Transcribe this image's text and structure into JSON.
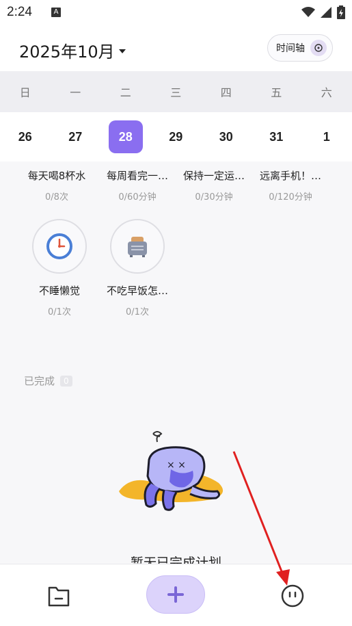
{
  "status_bar": {
    "time": "2:24",
    "notification_glyph": "A"
  },
  "header": {
    "month": "2025年10月",
    "timeline_label": "时间轴"
  },
  "weekdays": [
    "日",
    "一",
    "二",
    "三",
    "四",
    "五",
    "六"
  ],
  "dates": [
    "26",
    "27",
    "28",
    "29",
    "30",
    "31",
    "1"
  ],
  "selected_date": "28",
  "accent_color": "#8a6ef0",
  "habits_row1": [
    {
      "name": "每天喝8杯水",
      "progress": "0/8次"
    },
    {
      "name": "每周看完一…",
      "progress": "0/60分钟"
    },
    {
      "name": "保持一定运…",
      "progress": "0/30分钟"
    },
    {
      "name": "远离手机！…",
      "progress": "0/120分钟"
    }
  ],
  "habits_row2": [
    {
      "name": "不睡懒觉",
      "progress": "0/1次",
      "icon": "clock-icon"
    },
    {
      "name": "不吃早饭怎…",
      "progress": "0/1次",
      "icon": "toaster-icon"
    }
  ],
  "completed": {
    "label": "已完成",
    "count": "0"
  },
  "empty_state": {
    "text": "暂无已完成计划"
  },
  "bottom_nav": {
    "left_icon": "folder-icon",
    "center_icon": "plus-icon",
    "right_icon": "face-icon"
  }
}
